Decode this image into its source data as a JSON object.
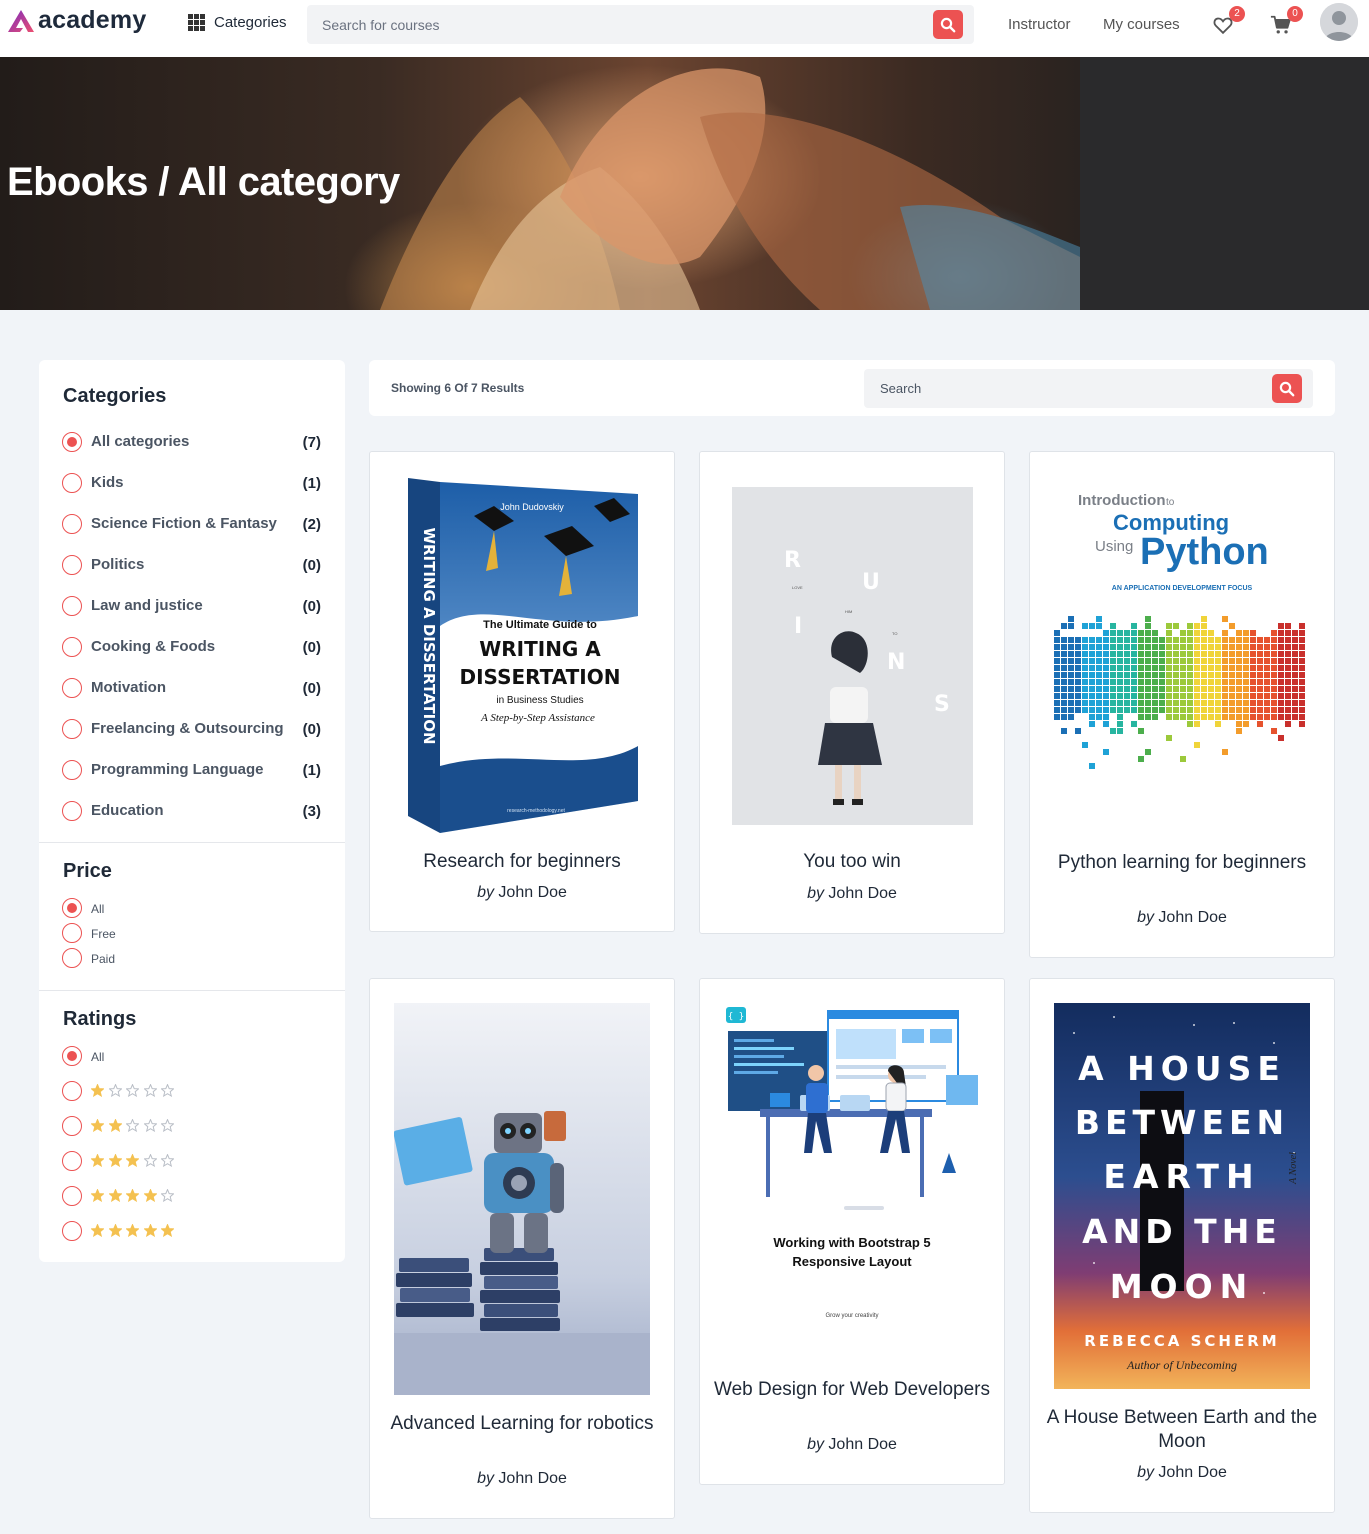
{
  "header": {
    "logo_text": "academy",
    "categories_label": "Categories",
    "search_placeholder": "Search for courses",
    "nav": {
      "instructor": "Instructor",
      "my_courses": "My courses"
    },
    "wishlist_count": "2",
    "cart_count": "0"
  },
  "hero": {
    "title": "Ebooks / All category"
  },
  "sidebar": {
    "categories_heading": "Categories",
    "categories": [
      {
        "label": "All categories",
        "count": "(7)",
        "checked": true
      },
      {
        "label": "Kids",
        "count": "(1)",
        "checked": false
      },
      {
        "label": "Science Fiction & Fantasy",
        "count": "(2)",
        "checked": false
      },
      {
        "label": "Politics",
        "count": "(0)",
        "checked": false
      },
      {
        "label": "Law and justice",
        "count": "(0)",
        "checked": false
      },
      {
        "label": "Cooking & Foods",
        "count": "(0)",
        "checked": false
      },
      {
        "label": "Motivation",
        "count": "(0)",
        "checked": false
      },
      {
        "label": "Freelancing & Outsourcing",
        "count": "(0)",
        "checked": false
      },
      {
        "label": "Programming Language",
        "count": "(1)",
        "checked": false
      },
      {
        "label": "Education",
        "count": "(3)",
        "checked": false
      }
    ],
    "price_heading": "Price",
    "price_options": [
      {
        "label": "All",
        "checked": true
      },
      {
        "label": "Free",
        "checked": false
      },
      {
        "label": "Paid",
        "checked": false
      }
    ],
    "ratings_heading": "Ratings",
    "ratings_all_label": "All",
    "ratings_options": [
      1,
      2,
      3,
      4,
      5
    ]
  },
  "results": {
    "showing_text": "Showing 6 Of 7 Results",
    "search_placeholder": "Search"
  },
  "ebooks": [
    {
      "title": "Research for beginners",
      "by": "by",
      "author": "John Doe",
      "cover": {
        "author_line": "John Dudovskiy",
        "spine": "WRITING A DISSERTATION",
        "line1": "The Ultimate Guide to",
        "line2": "WRITING A",
        "line3": "DISSERTATION",
        "line4": "in Business Studies",
        "line5": "A Step-by-Step Assistance",
        "footer": "research-methodology.net"
      }
    },
    {
      "title": "You too win",
      "by": "by",
      "author": "John Doe",
      "cover": {
        "letters": [
          "R",
          "U",
          "I",
          "N",
          "S"
        ],
        "small": [
          "LOVE",
          "HIM",
          "TO"
        ]
      }
    },
    {
      "title": "Python learning for beginners",
      "by": "by",
      "author": "John Doe",
      "cover": {
        "intro": "Introduction",
        "to": "to",
        "computing": "Computing",
        "using": "Using",
        "python": "Python",
        "subtitle": "AN APPLICATION DEVELOPMENT FOCUS"
      }
    },
    {
      "title": "Advanced Learning for robotics",
      "by": "by",
      "author": "John Doe",
      "cover": {}
    },
    {
      "title": "Web Design for Web Developers",
      "by": "by",
      "author": "John Doe",
      "cover": {
        "heading1": "Working with Bootstrap 5",
        "heading2": "Responsive Layout",
        "tagline": "Grow your creativity"
      }
    },
    {
      "title": "A House Between Earth and the Moon",
      "by": "by",
      "author": "John Doe",
      "cover": {
        "lines": [
          "A HOUSE",
          "BETWEEN",
          "EARTH",
          "AND THE",
          "MOON"
        ],
        "author_name": "REBECCA SCHERM",
        "author_note": "Author of Unbecoming",
        "side": "A Novel"
      }
    }
  ],
  "colors": {
    "accent": "#ec5252",
    "star": "#f4c150",
    "page_bg": "#f1f4f8"
  }
}
